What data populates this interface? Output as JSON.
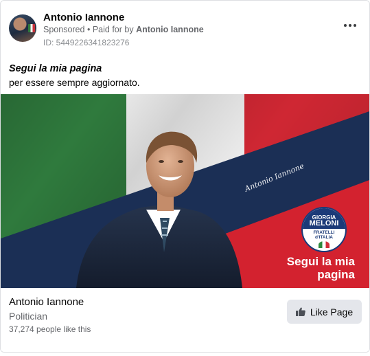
{
  "post": {
    "page_name": "Antonio Iannone",
    "sponsored": "Sponsored",
    "separator": "•",
    "paid_for_prefix": "Paid for by",
    "paid_for_name": "Antonio Iannone",
    "ad_id": "ID: 5449226341823276",
    "headline": "Segui la mia pagina",
    "body": "per essere sempre aggiornato.",
    "more_icon": "more-options-icon"
  },
  "creative": {
    "signature": "Antonio Iannone",
    "cta": "Segui la mia pagina",
    "logo_line1": "GIORGIA",
    "logo_line2": "MELONI",
    "logo_line3": "FRATELLI",
    "logo_line4": "d'ITALIA",
    "colors": {
      "green": "#2f7a3d",
      "white": "#f2f2f2",
      "red": "#d3222f",
      "navy": "#1b2f55"
    }
  },
  "footer": {
    "name": "Antonio Iannone",
    "category": "Politician",
    "likes": "37,274 people like this",
    "like_button": "Like Page",
    "like_icon": "thumbs-up-icon"
  }
}
